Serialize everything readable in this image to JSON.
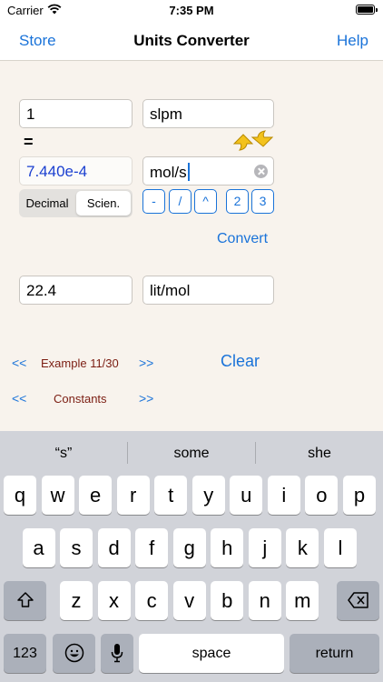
{
  "status": {
    "carrier": "Carrier",
    "time": "7:35 PM"
  },
  "nav": {
    "left": "Store",
    "title": "Units Converter",
    "right": "Help"
  },
  "converter": {
    "input_value": "1",
    "input_unit": "slpm",
    "equals": "=",
    "result_value": "7.440e-4",
    "result_unit": "mol/s",
    "format": {
      "options": [
        "Decimal",
        "Scien."
      ],
      "selected": "Scien."
    },
    "ops": [
      "-",
      "/",
      "^",
      "2",
      "3"
    ],
    "convert": "Convert",
    "factor_value": "22.4",
    "factor_unit": "lit/mol"
  },
  "examples": {
    "prev": "<<",
    "next": ">>",
    "example_label": "Example 11/30",
    "clear": "Clear",
    "constants_label": "Constants"
  },
  "keyboard": {
    "suggestions": [
      "“s”",
      "some",
      "she"
    ],
    "row1": [
      "q",
      "w",
      "e",
      "r",
      "t",
      "y",
      "u",
      "i",
      "o",
      "p"
    ],
    "row2": [
      "a",
      "s",
      "d",
      "f",
      "g",
      "h",
      "j",
      "k",
      "l"
    ],
    "row3": [
      "z",
      "x",
      "c",
      "v",
      "b",
      "n",
      "m"
    ],
    "numbers": "123",
    "space": "space",
    "return": "return"
  },
  "colors": {
    "accent": "#1a73d9",
    "result_text": "#1a3fd0",
    "example_text": "#7b1d12",
    "background": "#f8f3ed"
  }
}
